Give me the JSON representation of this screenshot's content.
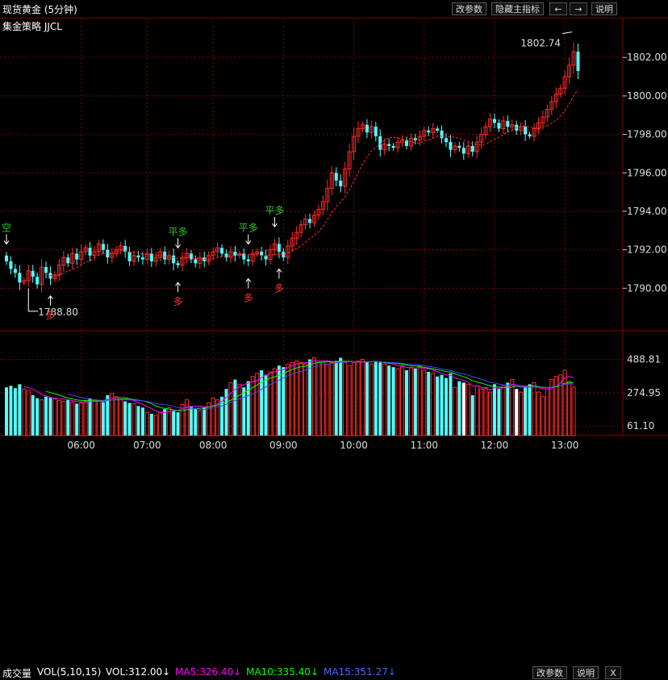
{
  "header": {
    "title": "现货黄金 (5分钟)",
    "subtitle": "集金策略 JJCL",
    "btn_params": "改参数",
    "btn_hide": "隐藏主指标",
    "btn_left": "←",
    "btn_right": "→",
    "btn_help": "说明"
  },
  "volume_header": {
    "label": "成交量",
    "vol_label": "VOL(5,10,15)",
    "vol_value": "VOL:312.00↓",
    "ma5": "MA5:326.40↓",
    "ma10": "MA10:335.40↓",
    "ma15": "MA15:351.27↓",
    "btn_params": "改参数",
    "btn_help": "说明",
    "btn_close": "X"
  },
  "annotations": {
    "price_high": "1802.74",
    "price_low": "1788.80"
  },
  "signals": [
    {
      "text": "空",
      "color": "#22cc22",
      "index": 0,
      "pos": "above"
    },
    {
      "text": "多",
      "color": "#ff3333",
      "index": 10,
      "pos": "below"
    },
    {
      "text": "平多",
      "color": "#22cc22",
      "index": 39,
      "pos": "above"
    },
    {
      "text": "多",
      "color": "#ff3333",
      "index": 39,
      "pos": "below"
    },
    {
      "text": "平多",
      "color": "#22cc22",
      "index": 55,
      "pos": "above"
    },
    {
      "text": "多",
      "color": "#ff3333",
      "index": 55,
      "pos": "below"
    },
    {
      "text": "平多",
      "color": "#22cc22",
      "index": 61,
      "pos": "above"
    },
    {
      "text": "多",
      "color": "#ff3333",
      "index": 62,
      "pos": "below"
    }
  ],
  "colors": {
    "up": "#ff2a2a",
    "down": "#54ffff",
    "grid": "#8b0000",
    "ma5": "#ff00ff",
    "ma10": "#00ff00",
    "ma15": "#4444ff",
    "vol_white": "#ffffff"
  },
  "chart_data": {
    "type": "candlestick",
    "price_axis": {
      "ticks": [
        "1802.00",
        "1800.00",
        "1798.00",
        "1796.00",
        "1794.00",
        "1792.00",
        "1790.00"
      ],
      "ylim": [
        1788.0,
        1803.1
      ]
    },
    "volume_axis": {
      "ticks": [
        "488.81",
        "274.95",
        "61.10"
      ],
      "ylim": [
        0,
        560
      ]
    },
    "time_ticks": [
      {
        "label": "06:00",
        "index": 17
      },
      {
        "label": "07:00",
        "index": 32
      },
      {
        "label": "08:00",
        "index": 47
      },
      {
        "label": "09:00",
        "index": 63
      },
      {
        "label": "10:00",
        "index": 79
      },
      {
        "label": "11:00",
        "index": 95
      },
      {
        "label": "12:00",
        "index": 111
      },
      {
        "label": "13:00",
        "index": 127
      }
    ],
    "closes": [
      1791.4,
      1791.0,
      1790.8,
      1790.3,
      1790.4,
      1790.9,
      1790.6,
      1790.2,
      1791.1,
      1790.8,
      1790.5,
      1790.7,
      1791.2,
      1791.6,
      1791.3,
      1791.8,
      1791.5,
      1791.9,
      1792.1,
      1791.7,
      1791.9,
      1792.3,
      1792.0,
      1791.6,
      1791.8,
      1792.0,
      1792.2,
      1791.9,
      1791.4,
      1791.7,
      1791.6,
      1791.5,
      1791.8,
      1791.4,
      1791.6,
      1791.9,
      1791.5,
      1791.7,
      1791.3,
      1791.2,
      1791.6,
      1791.8,
      1791.5,
      1791.3,
      1791.6,
      1791.4,
      1791.7,
      1791.9,
      1792.1,
      1791.8,
      1791.6,
      1791.9,
      1791.7,
      1791.8,
      1791.5,
      1791.4,
      1791.8,
      1791.9,
      1791.7,
      1791.5,
      1792.0,
      1792.3,
      1791.9,
      1791.6,
      1792.2,
      1792.6,
      1792.9,
      1793.3,
      1793.6,
      1793.4,
      1793.8,
      1794.1,
      1794.5,
      1795.2,
      1796.0,
      1795.6,
      1795.3,
      1796.2,
      1797.1,
      1797.9,
      1798.3,
      1798.5,
      1798.1,
      1798.4,
      1797.9,
      1797.2,
      1797.5,
      1797.4,
      1797.3,
      1797.6,
      1797.7,
      1797.4,
      1797.8,
      1797.7,
      1797.9,
      1798.2,
      1798.1,
      1798.3,
      1798.2,
      1797.8,
      1797.6,
      1797.2,
      1797.4,
      1797.3,
      1797.0,
      1797.4,
      1797.1,
      1797.6,
      1798.0,
      1798.4,
      1798.8,
      1798.6,
      1798.3,
      1798.7,
      1798.4,
      1798.5,
      1798.2,
      1798.4,
      1798.0,
      1797.9,
      1798.3,
      1798.6,
      1798.9,
      1799.3,
      1799.7,
      1800.1,
      1800.4,
      1801.0,
      1801.6,
      1802.3,
      1801.3
    ],
    "volumes": [
      310,
      320,
      305,
      330,
      300,
      290,
      260,
      240,
      230,
      250,
      245,
      235,
      225,
      220,
      230,
      215,
      205,
      210,
      220,
      240,
      230,
      225,
      215,
      260,
      270,
      250,
      230,
      220,
      210,
      205,
      190,
      180,
      150,
      140,
      130,
      150,
      170,
      180,
      160,
      150,
      200,
      230,
      190,
      170,
      160,
      180,
      210,
      240,
      230,
      250,
      300,
      340,
      360,
      330,
      310,
      350,
      380,
      400,
      420,
      390,
      410,
      430,
      450,
      440,
      460,
      470,
      480,
      470,
      460,
      490,
      500,
      470,
      480,
      460,
      470,
      480,
      500,
      470,
      450,
      470,
      480,
      490,
      470,
      460,
      480,
      470,
      460,
      450,
      440,
      430,
      450,
      420,
      440,
      430,
      450,
      420,
      410,
      400,
      380,
      390,
      370,
      400,
      310,
      350,
      340,
      330,
      260,
      320,
      300,
      310,
      280,
      330,
      300,
      320,
      340,
      360,
      300,
      280,
      310,
      330,
      340,
      280,
      250,
      300,
      360,
      380,
      390,
      420,
      350,
      312
    ]
  }
}
